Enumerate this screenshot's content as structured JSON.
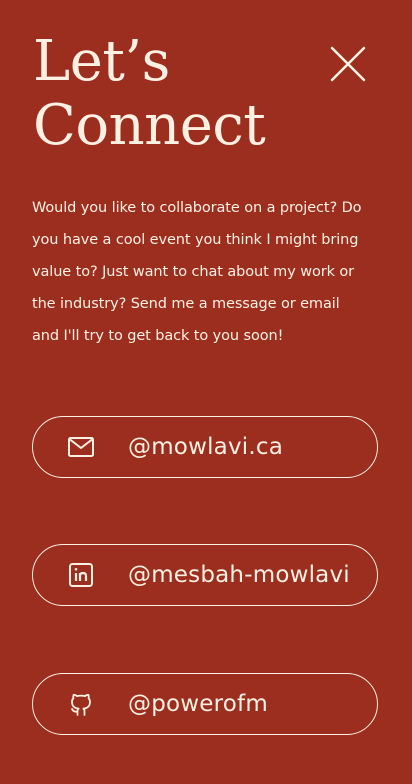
{
  "header": {
    "title_line1": "Let’s",
    "title_line2": "Connect",
    "close_icon": "close-icon"
  },
  "intro": {
    "text": "Would you like to collaborate on a project? Do you have a cool event you think I might bring value to? Just want to chat about my work or the industry? Send me a message or email and I'll try to get back to you soon!"
  },
  "contacts": [
    {
      "icon": "mail-icon",
      "label": "@mowlavi.ca"
    },
    {
      "icon": "linkedin-icon",
      "label": "@mesbah-mowlavi"
    },
    {
      "icon": "github-icon",
      "label": "@powerofm"
    }
  ],
  "colors": {
    "background": "#9c2e1f",
    "foreground": "#fbf0e2"
  }
}
